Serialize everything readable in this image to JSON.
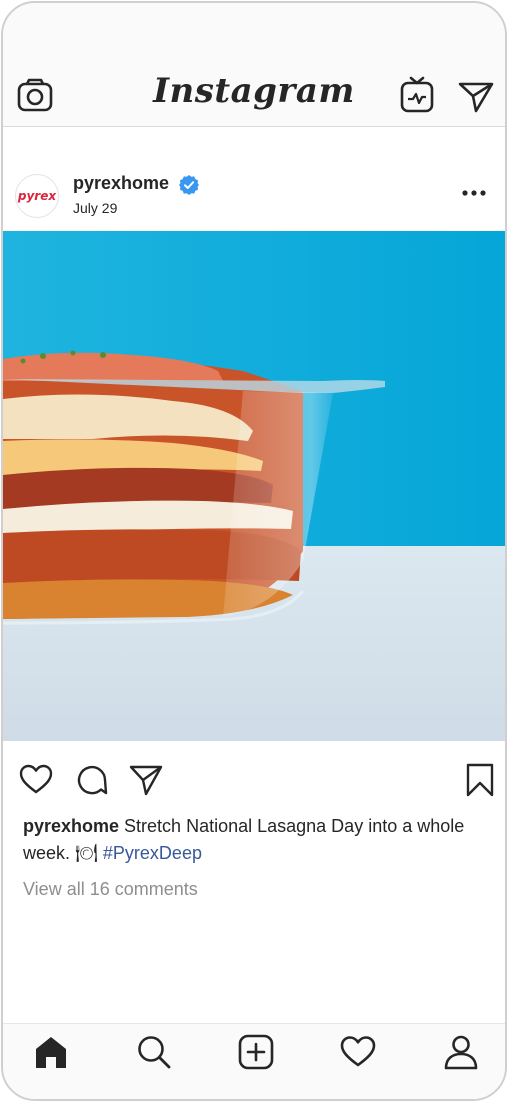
{
  "app": {
    "name": "Instagram"
  },
  "header": {
    "icons": [
      "camera-icon",
      "igtv-icon",
      "direct-message-icon"
    ]
  },
  "post": {
    "username": "pyrexhome",
    "verified": true,
    "date": "July 29",
    "avatar_text": "pyrex",
    "image_alt": "lasagna in glass baking dish",
    "caption": {
      "user": "pyrexhome",
      "text": " Stretch National Lasagna Day into a whole week. ",
      "emoji": "🍽",
      "hashtag": "#PyrexDeep"
    },
    "comments_label": "View all 16 comments"
  },
  "actions": [
    "like-icon",
    "comment-icon",
    "share-icon",
    "bookmark-icon"
  ],
  "bottom_nav": [
    "home-icon",
    "search-icon",
    "new-post-icon",
    "activity-icon",
    "profile-icon"
  ],
  "colors": {
    "hashtag": "#385898",
    "verified": "#3897f0",
    "brand_red": "#d7263d",
    "sky": "#1aaed9"
  }
}
